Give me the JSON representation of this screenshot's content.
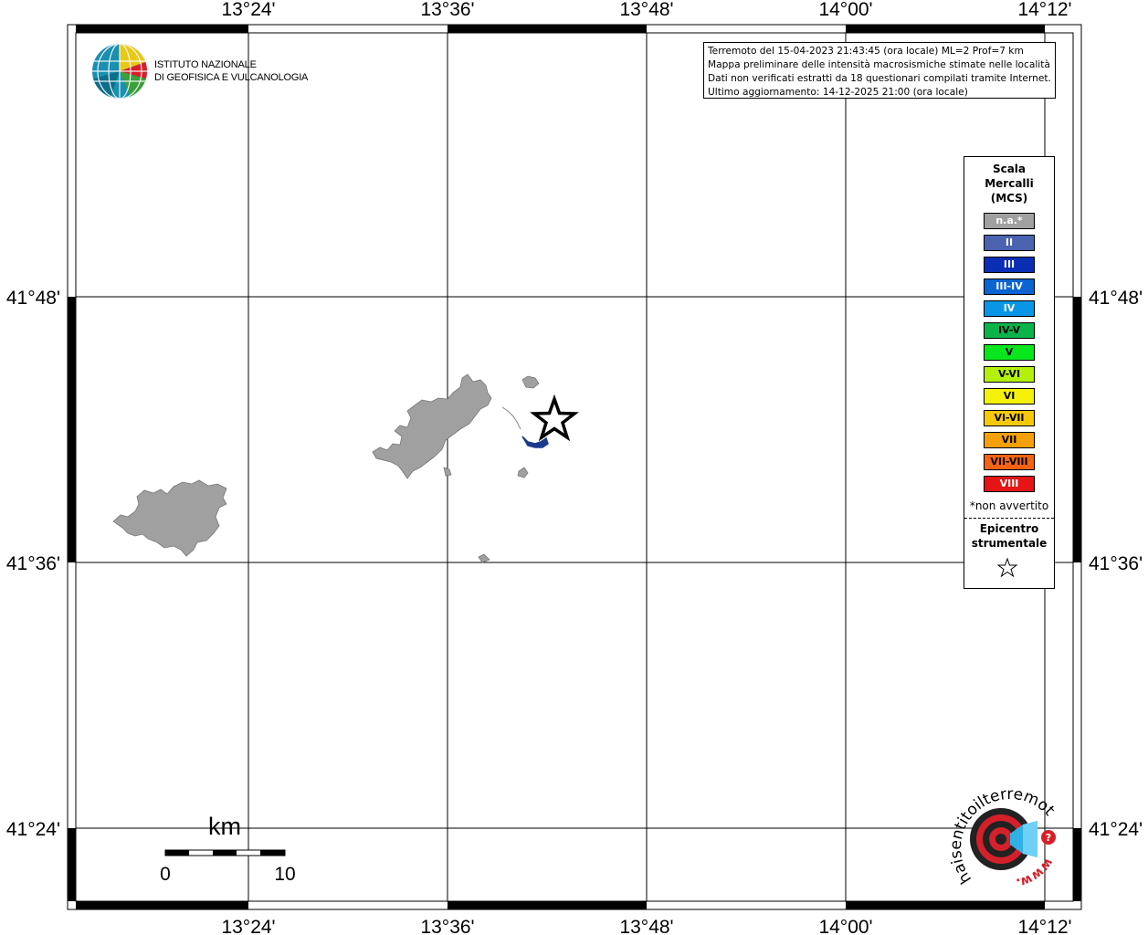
{
  "map": {
    "lon_ticks": [
      "13°24'",
      "13°36'",
      "13°48'",
      "14°00'",
      "14°12'"
    ],
    "lat_ticks": [
      "41°48'",
      "41°36'",
      "41°24'"
    ]
  },
  "info": {
    "line1": "Terremoto del 15-04-2023 21:43:45 (ora locale) ML=2 Prof=7 km",
    "line2": "Mappa preliminare delle intensità macrosismiche stimate nelle località",
    "line3": "Dati non verificati estratti da 18 questionari compilati tramite Internet.",
    "line4": "Ultimo aggiornamento: 14-12-2025 21:00 (ora locale)"
  },
  "legend": {
    "title_lines": [
      "Scala",
      "Mercalli",
      "(MCS)"
    ],
    "items": [
      {
        "label": "n.a.*",
        "color": "#a0a0a0",
        "text_color": "#ffffff"
      },
      {
        "label": "II",
        "color": "#4a62b0",
        "text_color": "#ffffff"
      },
      {
        "label": "III",
        "color": "#0a2eb4",
        "text_color": "#ffffff"
      },
      {
        "label": "III-IV",
        "color": "#0a64d2",
        "text_color": "#ffffff"
      },
      {
        "label": "IV",
        "color": "#0a96e6",
        "text_color": "#ffffff"
      },
      {
        "label": "IV-V",
        "color": "#0ab44a",
        "text_color": "#000000"
      },
      {
        "label": "V",
        "color": "#0ae61e",
        "text_color": "#000000"
      },
      {
        "label": "V-VI",
        "color": "#b4f00a",
        "text_color": "#000000"
      },
      {
        "label": "VI",
        "color": "#f5f00a",
        "text_color": "#000000"
      },
      {
        "label": "VI-VII",
        "color": "#f5c80a",
        "text_color": "#000000"
      },
      {
        "label": "VII",
        "color": "#f5a00a",
        "text_color": "#000000"
      },
      {
        "label": "VII-VIII",
        "color": "#f56414",
        "text_color": "#000000"
      },
      {
        "label": "VIII",
        "color": "#e61414",
        "text_color": "#ffffff"
      }
    ],
    "note": "*non avvertito",
    "epicenter_lines": [
      "Epicentro",
      "strumentale"
    ]
  },
  "scale_bar": {
    "unit": "km",
    "min_label": "0",
    "max_label": "10"
  },
  "logo": {
    "line1": "ISTITUTO NAZIONALE",
    "line2": "DI GEOFISICA E VULCANOLOGIA",
    "icon": "ingv-globe-icon"
  },
  "hsit_logo": {
    "ring_text": "haisentitoilterremoto.it",
    "www": "www.",
    "icon": "hsit-target-icon"
  },
  "colors": {
    "not_felt": "#a0a0a0",
    "intensity_ii": "#1c3a8c",
    "grid": "#000000"
  }
}
